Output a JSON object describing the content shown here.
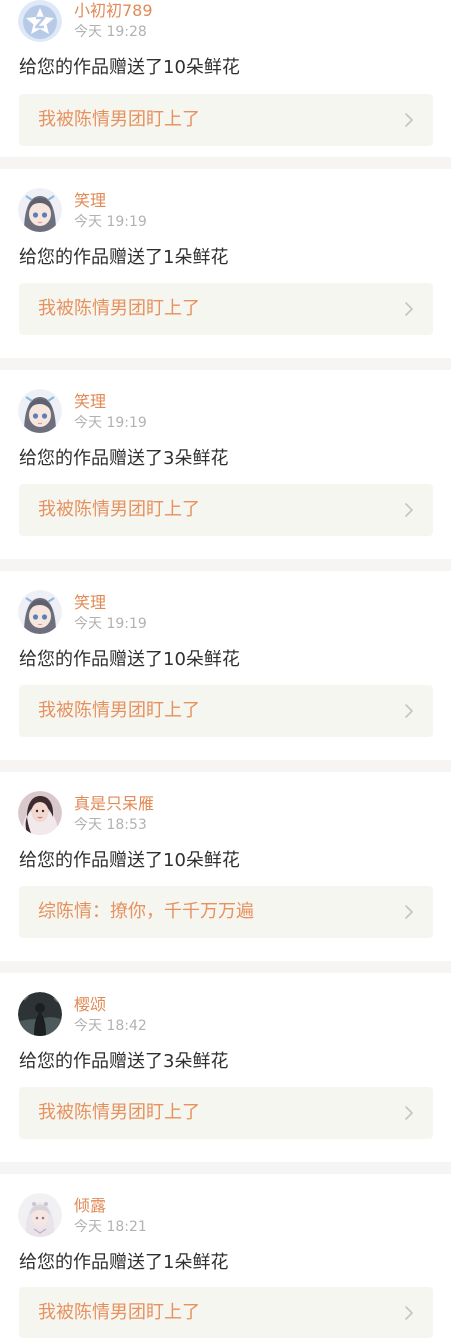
{
  "notifications": [
    {
      "username": "小初初789",
      "time": "今天 19:28",
      "message": "给您的作品赠送了10朵鲜花",
      "work_title": "我被陈情男团盯上了",
      "avatar": "default-z-avatar"
    },
    {
      "username": "笑理",
      "time": "今天 19:19",
      "message": "给您的作品赠送了1朵鲜花",
      "work_title": "我被陈情男团盯上了",
      "avatar": "anime-girl-avatar"
    },
    {
      "username": "笑理",
      "time": "今天 19:19",
      "message": "给您的作品赠送了3朵鲜花",
      "work_title": "我被陈情男团盯上了",
      "avatar": "anime-girl-avatar"
    },
    {
      "username": "笑理",
      "time": "今天 19:19",
      "message": "给您的作品赠送了10朵鲜花",
      "work_title": "我被陈情男团盯上了",
      "avatar": "anime-girl-avatar"
    },
    {
      "username": "真是只呆雁",
      "time": "今天 18:53",
      "message": "给您的作品赠送了10朵鲜花",
      "work_title": "综陈情：撩你，千千万万遍",
      "avatar": "portrait-avatar"
    },
    {
      "username": "樱颂",
      "time": "今天 18:42",
      "message": "给您的作品赠送了3朵鲜花",
      "work_title": "我被陈情男团盯上了",
      "avatar": "dark-figure-avatar"
    },
    {
      "username": "倾露",
      "time": "今天 18:21",
      "message": "给您的作品赠送了1朵鲜花",
      "work_title": "我被陈情男团盯上了",
      "avatar": "white-hair-girl-avatar"
    }
  ],
  "colors": {
    "username": "#e28a56",
    "work_title": "#e6915e",
    "time": "#b2b2b2",
    "message": "#2f2f2f",
    "link_background": "#f6f6f1",
    "divider": "#f7f5f4"
  }
}
